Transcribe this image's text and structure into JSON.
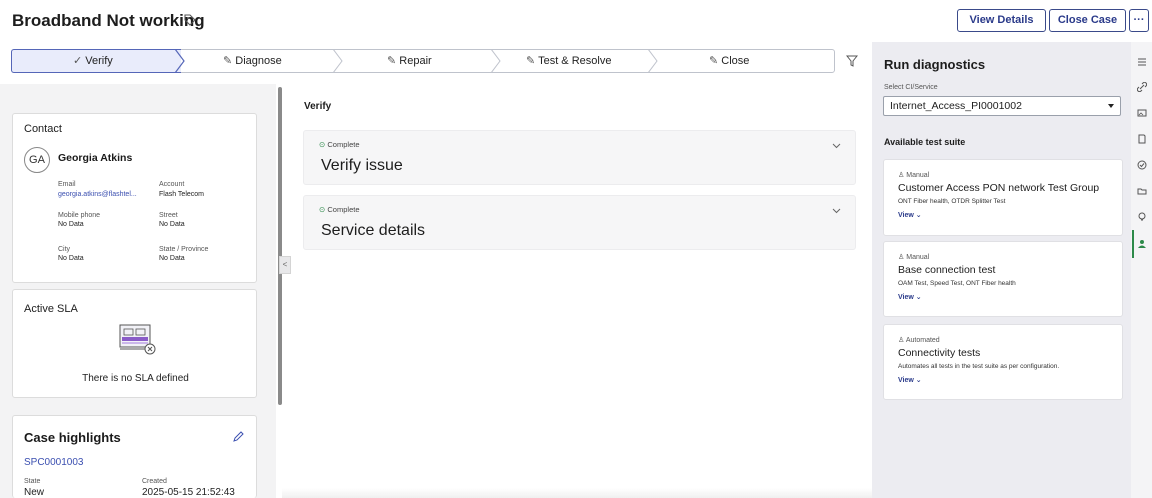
{
  "header": {
    "title": "Broadband Not working",
    "view_details": "View Details",
    "close_case": "Close Case",
    "more": "···"
  },
  "stepper": {
    "steps": [
      {
        "label": "Verify",
        "icon": "check-icon",
        "active": true
      },
      {
        "label": "Diagnose",
        "icon": "pencil-icon"
      },
      {
        "label": "Repair",
        "icon": "pencil-icon"
      },
      {
        "label": "Test & Resolve",
        "icon": "pencil-icon"
      },
      {
        "label": "Close",
        "icon": "pencil-icon"
      }
    ],
    "check_glyph": "✓",
    "pencil_glyph": "✎"
  },
  "contact": {
    "title": "Contact",
    "initials": "GA",
    "name": "Georgia Atkins",
    "email_label": "Email",
    "email": "georgia.atkins@flashtel...",
    "account_label": "Account",
    "account": "Flash Telecom",
    "mobile_label": "Mobile phone",
    "mobile": "No Data",
    "street_label": "Street",
    "street": "No Data",
    "city_label": "City",
    "city": "No Data",
    "state_label": "State / Province",
    "state": "No Data"
  },
  "sla": {
    "title": "Active SLA",
    "empty": "There is no SLA defined"
  },
  "highlights": {
    "title": "Case highlights",
    "number": "SPC0001003",
    "state_label": "State",
    "state": "New",
    "created_label": "Created",
    "created": "2025-05-15 21:52:43"
  },
  "main": {
    "section": "Verify",
    "items": [
      {
        "status": "Complete",
        "title": "Verify issue"
      },
      {
        "status": "Complete",
        "title": "Service details"
      }
    ],
    "status_glyph": "⊙"
  },
  "diagnostics": {
    "title": "Run diagnostics",
    "select_label": "Select CI/Service",
    "select_value": "Internet_Access_PI0001002",
    "suite_title": "Available test suite",
    "tests": [
      {
        "type": "Manual",
        "name": "Customer Access PON network Test Group",
        "desc": "ONT Fiber health, OTDR Splitter Test",
        "view": "View ⌄"
      },
      {
        "type": "Manual",
        "name": "Base connection test",
        "desc": "OAM Test, Speed Test, ONT Fiber health",
        "view": "View ⌄"
      },
      {
        "type": "Automated",
        "name": "Connectivity tests",
        "desc": "Automates all tests in the test suite as per configuration.",
        "view": "View ⌄"
      }
    ],
    "person_glyph": "♙"
  },
  "rail": {
    "icons": [
      "list-icon",
      "link-icon",
      "image-icon",
      "document-icon",
      "check-circle-icon",
      "folder-icon",
      "lightbulb-icon",
      "person-icon"
    ]
  },
  "colors": {
    "accent": "#2a3a8a",
    "link": "#3b4fb0",
    "complete": "#2d8a4a",
    "panel_bg": "#ececf1"
  }
}
